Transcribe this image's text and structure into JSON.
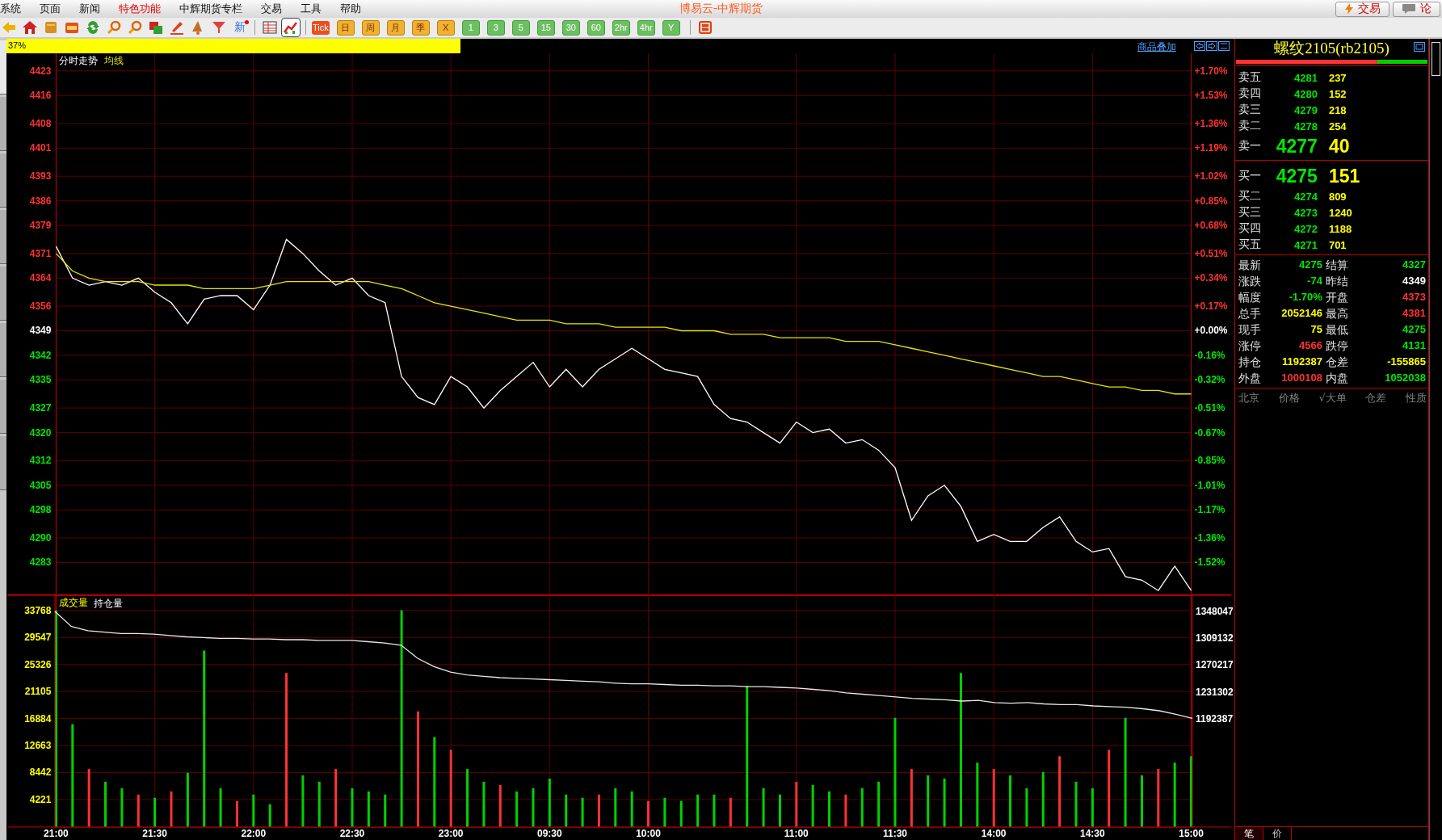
{
  "menu": {
    "items": [
      {
        "label": "系统",
        "highlighted": false
      },
      {
        "label": "页面",
        "highlighted": false
      },
      {
        "label": "新闻",
        "highlighted": false
      },
      {
        "label": "特色功能",
        "highlighted": true
      },
      {
        "label": "中辉期货专栏",
        "highlighted": false
      },
      {
        "label": "交易",
        "highlighted": false
      },
      {
        "label": "工具",
        "highlighted": false
      },
      {
        "label": "帮助",
        "highlighted": false
      }
    ],
    "title": "博易云-中辉期货",
    "buttons": [
      {
        "label": "交易",
        "kind": "trade"
      },
      {
        "label": "论",
        "kind": "forum"
      }
    ]
  },
  "toolbar": {
    "tools": [
      {
        "selected": false
      },
      {
        "selected": false
      },
      {
        "selected": false
      },
      {
        "selected": false
      },
      {
        "selected": false
      },
      {
        "selected": false
      },
      {
        "selected": false
      },
      {
        "selected": false
      },
      {
        "selected": false
      },
      {
        "selected": false
      },
      {
        "selected": false
      }
    ],
    "new_button": {
      "label": "新"
    },
    "views": [
      {
        "selected": false
      },
      {
        "selected": true
      }
    ],
    "periods": [
      {
        "label": "Tick",
        "kind": "tick"
      },
      {
        "label": "日",
        "kind": "orange"
      },
      {
        "label": "周",
        "kind": "orange"
      },
      {
        "label": "月",
        "kind": "orange"
      },
      {
        "label": "季",
        "kind": "orange"
      },
      {
        "label": "X",
        "kind": "orange"
      },
      {
        "label": "1",
        "kind": "green"
      },
      {
        "label": "3",
        "kind": "green"
      },
      {
        "label": "5",
        "kind": "green"
      },
      {
        "label": "15",
        "kind": "green"
      },
      {
        "label": "30",
        "kind": "green"
      },
      {
        "label": "60",
        "kind": "green"
      },
      {
        "label": "2hr",
        "kind": "green"
      },
      {
        "label": "4hr",
        "kind": "green"
      },
      {
        "label": "Y",
        "kind": "green"
      }
    ],
    "extra": [
      {
        "selected": false
      }
    ]
  },
  "progress": {
    "label": "37%",
    "level": 0.37
  },
  "overlay_link": "商品叠加",
  "price_panel": {
    "percent_labels": [
      {
        "label": "+1.70%",
        "kind": "up"
      },
      {
        "label": "+1.53%",
        "kind": "up"
      },
      {
        "label": "+1.36%",
        "kind": "up"
      },
      {
        "label": "+1.19%",
        "kind": "up"
      },
      {
        "label": "+1.02%",
        "kind": "up"
      },
      {
        "label": "+0.85%",
        "kind": "up"
      },
      {
        "label": "+0.68%",
        "kind": "up"
      },
      {
        "label": "+0.51%",
        "kind": "up"
      },
      {
        "label": "+0.34%",
        "kind": "up"
      },
      {
        "label": "+0.17%",
        "kind": "up"
      },
      {
        "label": "+0.00%",
        "kind": "flat"
      },
      {
        "label": "-0.16%",
        "kind": "down"
      },
      {
        "label": "-0.32%",
        "kind": "down"
      },
      {
        "label": "-0.51%",
        "kind": "down"
      },
      {
        "label": "-0.67%",
        "kind": "down"
      },
      {
        "label": "-0.85%",
        "kind": "down"
      },
      {
        "label": "-1.01%",
        "kind": "down"
      },
      {
        "label": "-1.17%",
        "kind": "down"
      },
      {
        "label": "-1.36%",
        "kind": "down"
      },
      {
        "label": "-1.52%",
        "kind": "down"
      }
    ],
    "chart_data": {
      "type": "line",
      "grid": true,
      "ylim": [
        4274,
        4428
      ],
      "yticks": [
        4423,
        4416,
        4408,
        4401,
        4393,
        4386,
        4379,
        4371,
        4364,
        4356,
        4349,
        4342,
        4335,
        4327,
        4320,
        4312,
        4305,
        4298,
        4290,
        4283
      ],
      "series": [
        {
          "name": "分时走势",
          "color": "#ffffff",
          "values": [
            4373,
            4364,
            4362,
            4363,
            4362,
            4364,
            4360,
            4357,
            4351,
            4358,
            4359,
            4359,
            4355,
            4362,
            4375,
            4371,
            4366,
            4362,
            4364,
            4359,
            4357,
            4336,
            4330,
            4328,
            4336,
            4333,
            4327,
            4332,
            4336,
            4340,
            4333,
            4338,
            4333,
            4338,
            4341,
            4344,
            4341,
            4338,
            4337,
            4336,
            4328,
            4324,
            4323,
            4320,
            4317,
            4323,
            4320,
            4321,
            4317,
            4318,
            4315,
            4310,
            4295,
            4302,
            4305,
            4299,
            4289,
            4291,
            4289,
            4289,
            4293,
            4296,
            4289,
            4286,
            4287,
            4279,
            4278,
            4275,
            4282,
            4275
          ]
        },
        {
          "name": "均线",
          "color": "#e6e600",
          "values": [
            4371,
            4366,
            4364,
            4363,
            4363,
            4363,
            4362,
            4362,
            4362,
            4361,
            4361,
            4361,
            4361,
            4362,
            4363,
            4363,
            4363,
            4363,
            4363,
            4363,
            4362,
            4361,
            4359,
            4357,
            4356,
            4355,
            4354,
            4353,
            4352,
            4352,
            4352,
            4351,
            4351,
            4351,
            4350,
            4350,
            4350,
            4350,
            4349,
            4349,
            4349,
            4348,
            4348,
            4348,
            4347,
            4347,
            4347,
            4347,
            4346,
            4346,
            4346,
            4345,
            4344,
            4343,
            4342,
            4341,
            4340,
            4339,
            4338,
            4337,
            4336,
            4336,
            4335,
            4334,
            4333,
            4333,
            4332,
            4332,
            4331,
            4331
          ]
        }
      ]
    }
  },
  "volume_panel": {
    "chart_data": {
      "type": "bar",
      "title": "成交量",
      "stacked": true,
      "grid": true,
      "ylim": [
        0,
        36270
      ],
      "categories": [
        "21:00",
        null,
        null,
        null,
        null,
        null,
        "21:30",
        null,
        null,
        null,
        null,
        null,
        "22:00",
        null,
        null,
        null,
        null,
        null,
        "22:30",
        null,
        null,
        null,
        null,
        null,
        "23:00",
        null,
        null,
        null,
        null,
        null,
        "09:30",
        null,
        null,
        null,
        null,
        null,
        "10:00",
        null,
        null,
        null,
        null,
        null,
        null,
        null,
        null,
        "11:00",
        null,
        null,
        null,
        null,
        null,
        "11:30",
        null,
        null,
        null,
        null,
        null,
        "14:00",
        null,
        null,
        null,
        null,
        null,
        "14:30",
        null,
        null,
        null,
        null,
        null,
        "15:00"
      ],
      "yticks": [
        33768,
        29547,
        25326,
        21105,
        16884,
        12663,
        8442,
        4221
      ],
      "series": [
        {
          "color": "#00d200",
          "values": [
            33800,
            16000,
            null,
            7000,
            6000,
            null,
            4500,
            null,
            8400,
            27500,
            6000,
            null,
            5000,
            3500,
            null,
            8000,
            7000,
            null,
            6000,
            5500,
            5000,
            33800,
            null,
            14000,
            null,
            9000,
            7000,
            null,
            5500,
            6000,
            7500,
            5000,
            4500,
            null,
            6000,
            5500,
            null,
            4500,
            4000,
            5000,
            5000,
            null,
            22000,
            6000,
            5000,
            null,
            6500,
            5500,
            null,
            6000,
            7000,
            17000,
            null,
            8000,
            7500,
            24000,
            10000,
            null,
            8000,
            6000,
            8500,
            null,
            7000,
            6000,
            null,
            17000,
            8000,
            null,
            10000,
            11000
          ]
        },
        {
          "color": "#ff3232",
          "values": [
            null,
            null,
            9000,
            null,
            null,
            5000,
            null,
            5500,
            null,
            null,
            null,
            4000,
            null,
            null,
            24000,
            null,
            null,
            9000,
            null,
            null,
            null,
            null,
            18000,
            null,
            12000,
            null,
            null,
            6500,
            null,
            null,
            null,
            null,
            null,
            5000,
            null,
            null,
            4000,
            null,
            null,
            null,
            null,
            4500,
            null,
            null,
            null,
            7000,
            null,
            null,
            5000,
            null,
            null,
            null,
            9000,
            null,
            null,
            null,
            null,
            9000,
            null,
            null,
            null,
            11000,
            null,
            null,
            12000,
            null,
            null,
            9000,
            null,
            null
          ]
        }
      ]
    },
    "open_interest": {
      "chart_data": {
        "type": "line",
        "ylim": [
          1034400,
          1371300
        ],
        "yticks": [
          1348047,
          1309132,
          1270217,
          1231302,
          1192387
        ],
        "series": [
          {
            "name": "持仓量",
            "color": "#e8e8e8",
            "values": [
              1348000,
              1326000,
              1320000,
              1318000,
              1316000,
              1316000,
              1315000,
              1313000,
              1311000,
              1310000,
              1309000,
              1309000,
              1308000,
              1308000,
              1307000,
              1307000,
              1306000,
              1306000,
              1306000,
              1304000,
              1302000,
              1299000,
              1280000,
              1268000,
              1260000,
              1256000,
              1254000,
              1252000,
              1251000,
              1250000,
              1249000,
              1248000,
              1247000,
              1246000,
              1244000,
              1243000,
              1243000,
              1242000,
              1241000,
              1241000,
              1240000,
              1240000,
              1239000,
              1239000,
              1238000,
              1237000,
              1235000,
              1233000,
              1230000,
              1228000,
              1226000,
              1224000,
              1222000,
              1221000,
              1220000,
              1218000,
              1219000,
              1216000,
              1215000,
              1216000,
              1214000,
              1213000,
              1213000,
              1211000,
              1210000,
              1209000,
              1207000,
              1204000,
              1199000,
              1193000
            ]
          }
        ]
      }
    }
  },
  "quote": {
    "title": "螺纹2105(rb2105)",
    "ratio_bar": {
      "level": 0.74
    },
    "asks": [
      {
        "label": "卖五",
        "price": "4281",
        "volume": "237",
        "kind": "level"
      },
      {
        "label": "卖四",
        "price": "4280",
        "volume": "152",
        "kind": "level"
      },
      {
        "label": "卖三",
        "price": "4279",
        "volume": "218",
        "kind": "level"
      },
      {
        "label": "卖二",
        "price": "4278",
        "volume": "254",
        "kind": "level"
      },
      {
        "label": "卖一",
        "price": "4277",
        "volume": "40",
        "kind": "best"
      }
    ],
    "bids": [
      {
        "label": "买一",
        "price": "4275",
        "volume": "151",
        "kind": "best"
      },
      {
        "label": "买二",
        "price": "4274",
        "volume": "809",
        "kind": "level"
      },
      {
        "label": "买三",
        "price": "4273",
        "volume": "1240",
        "kind": "level"
      },
      {
        "label": "买四",
        "price": "4272",
        "volume": "1188",
        "kind": "level"
      },
      {
        "label": "买五",
        "price": "4271",
        "volume": "701",
        "kind": "level"
      }
    ],
    "stats": [
      {
        "label": "最新",
        "value": "4275",
        "color": "#00e600"
      },
      {
        "label": "结算",
        "value": "4327",
        "color": "#00e600"
      },
      {
        "label": "涨跌",
        "value": "-74",
        "color": "#00e600"
      },
      {
        "label": "昨结",
        "value": "4349",
        "color": "#ffffff"
      },
      {
        "label": "幅度",
        "value": "-1.70%",
        "color": "#00e600"
      },
      {
        "label": "开盘",
        "value": "4373",
        "color": "#ff3232"
      },
      {
        "label": "总手",
        "value": "2052146",
        "color": "#ffff00"
      },
      {
        "label": "最高",
        "value": "4381",
        "color": "#ff3232"
      },
      {
        "label": "现手",
        "value": "75",
        "color": "#ffff00"
      },
      {
        "label": "最低",
        "value": "4275",
        "color": "#00e600"
      },
      {
        "label": "涨停",
        "value": "4566",
        "color": "#ff3232"
      },
      {
        "label": "跌停",
        "value": "4131",
        "color": "#00e600"
      },
      {
        "label": "持仓",
        "value": "1192387",
        "color": "#ffff00"
      },
      {
        "label": "仓差",
        "value": "-155865",
        "color": "#ffff00"
      },
      {
        "label": "外盘",
        "value": "1000108",
        "color": "#ff3232"
      },
      {
        "label": "内盘",
        "value": "1052038",
        "color": "#00e600"
      }
    ],
    "tick_columns": [
      "北京",
      "价格",
      "√大单",
      "仓差",
      "性质"
    ],
    "tabs": [
      {
        "label": "笔",
        "selected": true
      },
      {
        "label": "价",
        "selected": false
      }
    ]
  },
  "sidebar_tabs": [
    {
      "selected": true
    },
    {
      "selected": false
    },
    {
      "selected": false
    },
    {
      "selected": false
    },
    {
      "selected": false
    },
    {
      "selected": false
    },
    {
      "selected": false
    },
    {
      "selected": false
    }
  ]
}
